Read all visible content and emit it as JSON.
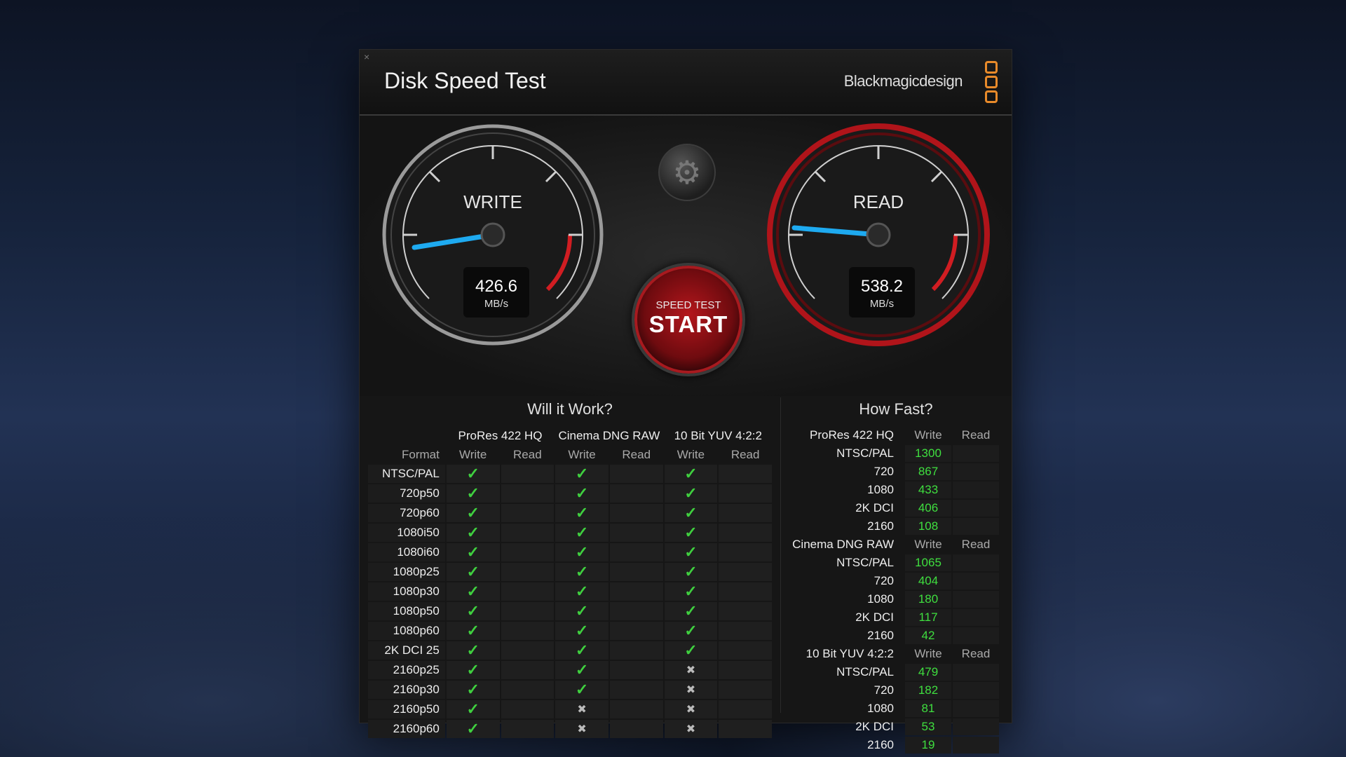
{
  "window": {
    "close": "×",
    "title": "Disk Speed Test",
    "brand": "Blackmagicdesign"
  },
  "gauges": {
    "write": {
      "label": "WRITE",
      "value": "426.6",
      "unit": "MB/s"
    },
    "read": {
      "label": "READ",
      "value": "538.2",
      "unit": "MB/s"
    }
  },
  "start": {
    "top": "SPEED TEST",
    "main": "START"
  },
  "will_it_work": {
    "title": "Will it Work?",
    "format_header": "Format",
    "groups": [
      "ProRes 422 HQ",
      "Cinema DNG RAW",
      "10 Bit YUV 4:2:2"
    ],
    "sub": [
      "Write",
      "Read"
    ],
    "rows": [
      {
        "format": "NTSC/PAL",
        "results": [
          "check",
          "",
          "check",
          "",
          "check",
          ""
        ]
      },
      {
        "format": "720p50",
        "results": [
          "check",
          "",
          "check",
          "",
          "check",
          ""
        ]
      },
      {
        "format": "720p60",
        "results": [
          "check",
          "",
          "check",
          "",
          "check",
          ""
        ]
      },
      {
        "format": "1080i50",
        "results": [
          "check",
          "",
          "check",
          "",
          "check",
          ""
        ]
      },
      {
        "format": "1080i60",
        "results": [
          "check",
          "",
          "check",
          "",
          "check",
          ""
        ]
      },
      {
        "format": "1080p25",
        "results": [
          "check",
          "",
          "check",
          "",
          "check",
          ""
        ]
      },
      {
        "format": "1080p30",
        "results": [
          "check",
          "",
          "check",
          "",
          "check",
          ""
        ]
      },
      {
        "format": "1080p50",
        "results": [
          "check",
          "",
          "check",
          "",
          "check",
          ""
        ]
      },
      {
        "format": "1080p60",
        "results": [
          "check",
          "",
          "check",
          "",
          "check",
          ""
        ]
      },
      {
        "format": "2K DCI 25",
        "results": [
          "check",
          "",
          "check",
          "",
          "check",
          ""
        ]
      },
      {
        "format": "2160p25",
        "results": [
          "check",
          "",
          "check",
          "",
          "cross",
          ""
        ]
      },
      {
        "format": "2160p30",
        "results": [
          "check",
          "",
          "check",
          "",
          "cross",
          ""
        ]
      },
      {
        "format": "2160p50",
        "results": [
          "check",
          "",
          "cross",
          "",
          "cross",
          ""
        ]
      },
      {
        "format": "2160p60",
        "results": [
          "check",
          "",
          "cross",
          "",
          "cross",
          ""
        ]
      }
    ]
  },
  "how_fast": {
    "title": "How Fast?",
    "write_header": "Write",
    "read_header": "Read",
    "groups": [
      {
        "name": "ProRes 422 HQ",
        "rows": [
          {
            "label": "NTSC/PAL",
            "write": "1300"
          },
          {
            "label": "720",
            "write": "867"
          },
          {
            "label": "1080",
            "write": "433"
          },
          {
            "label": "2K DCI",
            "write": "406"
          },
          {
            "label": "2160",
            "write": "108"
          }
        ]
      },
      {
        "name": "Cinema DNG RAW",
        "rows": [
          {
            "label": "NTSC/PAL",
            "write": "1065"
          },
          {
            "label": "720",
            "write": "404"
          },
          {
            "label": "1080",
            "write": "180"
          },
          {
            "label": "2K DCI",
            "write": "117"
          },
          {
            "label": "2160",
            "write": "42"
          }
        ]
      },
      {
        "name": "10 Bit YUV 4:2:2",
        "rows": [
          {
            "label": "NTSC/PAL",
            "write": "479"
          },
          {
            "label": "720",
            "write": "182"
          },
          {
            "label": "1080",
            "write": "81"
          },
          {
            "label": "2K DCI",
            "write": "53"
          },
          {
            "label": "2160",
            "write": "19"
          }
        ]
      }
    ]
  },
  "colors": {
    "accent_red": "#b4161c",
    "needle": "#1eaaf0",
    "ok": "#3fcf3f",
    "brand_orange": "#e88a2a"
  }
}
